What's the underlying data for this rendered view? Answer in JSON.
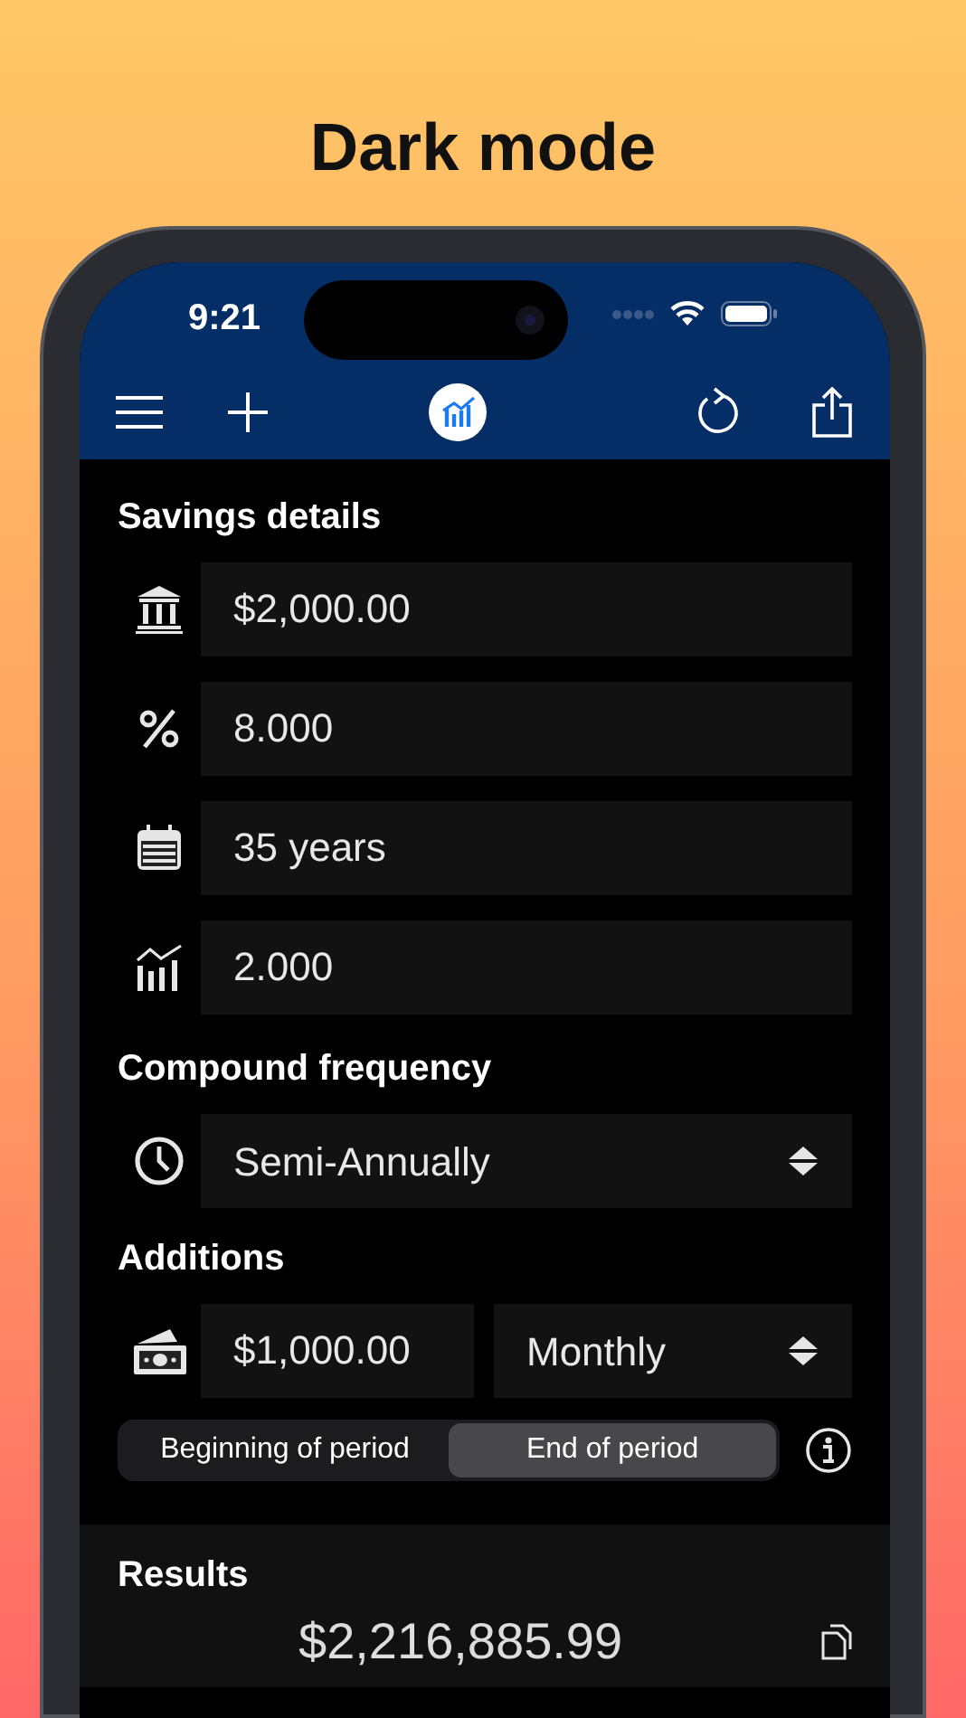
{
  "heading": "Dark mode",
  "status_bar": {
    "time": "9:21"
  },
  "savings": {
    "title": "Savings details",
    "fields": [
      {
        "value": "$2,000.00"
      },
      {
        "value": "8.000"
      },
      {
        "value": "35 years"
      },
      {
        "value": "2.000"
      }
    ]
  },
  "compound": {
    "title": "Compound frequency",
    "select": {
      "value": "Semi-Annually"
    }
  },
  "additions": {
    "title": "Additions",
    "amount": {
      "value": "$1,000.00"
    },
    "frequency": {
      "value": "Monthly"
    },
    "timing": [
      {
        "label": "Beginning of period",
        "selected": false
      },
      {
        "label": "End of period",
        "selected": true
      }
    ]
  },
  "results": {
    "title": "Results",
    "total": "$2,216,885.99"
  }
}
